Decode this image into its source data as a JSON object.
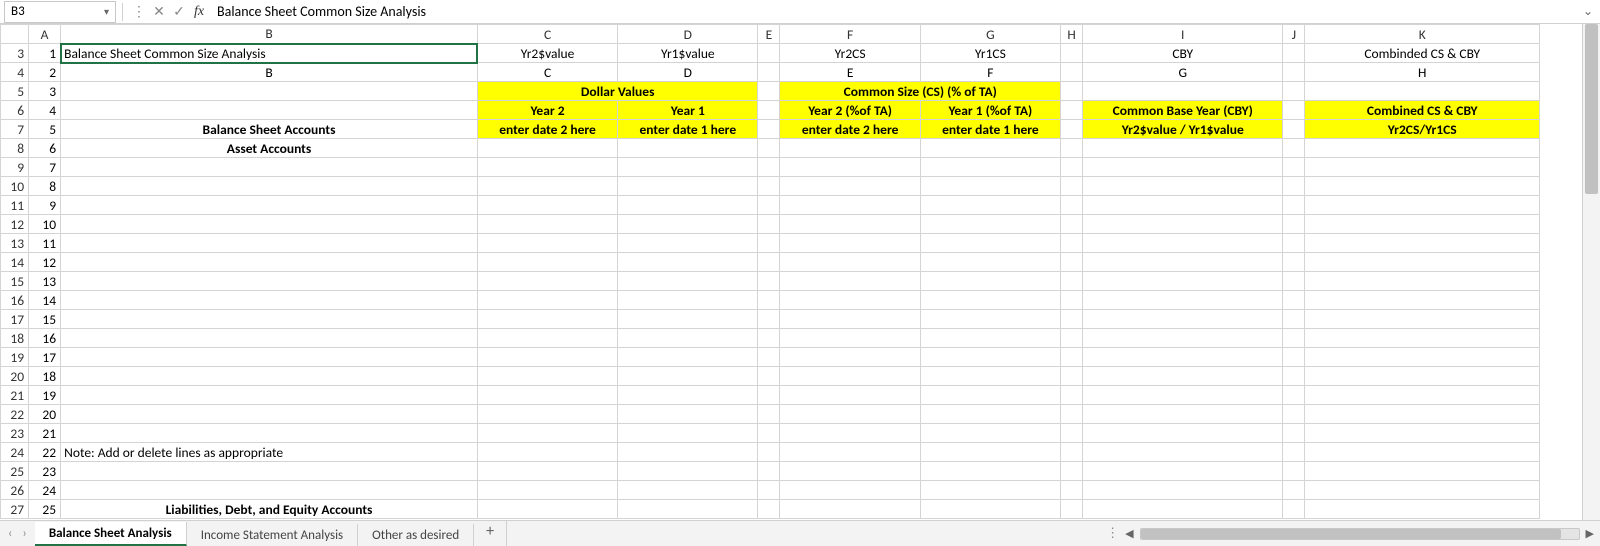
{
  "namebox": "B3",
  "formula_bar": "Balance Sheet Common Size Analysis",
  "col_headers": [
    "A",
    "B",
    "C",
    "D",
    "E",
    "F",
    "G",
    "H",
    "I",
    "J",
    "K"
  ],
  "row_start": 3,
  "row_end": 27,
  "rows": {
    "3": {
      "A": "1",
      "B": "Balance Sheet Common Size Analysis",
      "C": "Yr2$value",
      "D": "Yr1$value",
      "F": "Yr2CS",
      "G": "Yr1CS",
      "I": "CBY",
      "K": "Combinded CS & CBY"
    },
    "4": {
      "A": "2",
      "B": "B",
      "C": "C",
      "D": "D",
      "F": "E",
      "G": "F",
      "I": "G",
      "K": "H"
    },
    "5": {
      "A": "3",
      "CD": "Dollar Values",
      "FG": "Common Size (CS) (% of TA)"
    },
    "6": {
      "A": "4",
      "C": "Year 2",
      "D": "Year 1",
      "F": "Year 2 (%of TA)",
      "G": "Year 1 (%of TA)",
      "I": "Common Base Year (CBY)",
      "K": "Combined CS & CBY"
    },
    "7": {
      "A": "5",
      "B": "Balance Sheet Accounts",
      "C": "enter date 2 here",
      "D": "enter date 1 here",
      "F": "enter date 2 here",
      "G": "enter date 1 here",
      "I": "Yr2$value / Yr1$value",
      "K": "Yr2CS/Yr1CS"
    },
    "8": {
      "A": "6",
      "B": "Asset Accounts"
    },
    "9": {
      "A": "7"
    },
    "10": {
      "A": "8"
    },
    "11": {
      "A": "9"
    },
    "12": {
      "A": "10"
    },
    "13": {
      "A": "11"
    },
    "14": {
      "A": "12"
    },
    "15": {
      "A": "13"
    },
    "16": {
      "A": "14"
    },
    "17": {
      "A": "15"
    },
    "18": {
      "A": "16"
    },
    "19": {
      "A": "17"
    },
    "20": {
      "A": "18"
    },
    "21": {
      "A": "19"
    },
    "22": {
      "A": "20"
    },
    "23": {
      "A": "21"
    },
    "24": {
      "A": "22",
      "B": "Note: Add or delete lines as appropriate"
    },
    "25": {
      "A": "23"
    },
    "26": {
      "A": "24"
    },
    "27": {
      "A": "25",
      "B": "Liabilities, Debt, and Equity Accounts"
    }
  },
  "sheet_tabs": [
    "Balance Sheet Analysis",
    "Income Statement Analysis",
    "Other as desired"
  ],
  "active_tab": 0,
  "more_menu_glyph": "⋮",
  "hscroll_left": "◀",
  "hscroll_right": "▶",
  "nav_prev": "‹",
  "nav_next": "›",
  "add_tab": "+",
  "expand_glyph": "⌄",
  "chart_data": null
}
